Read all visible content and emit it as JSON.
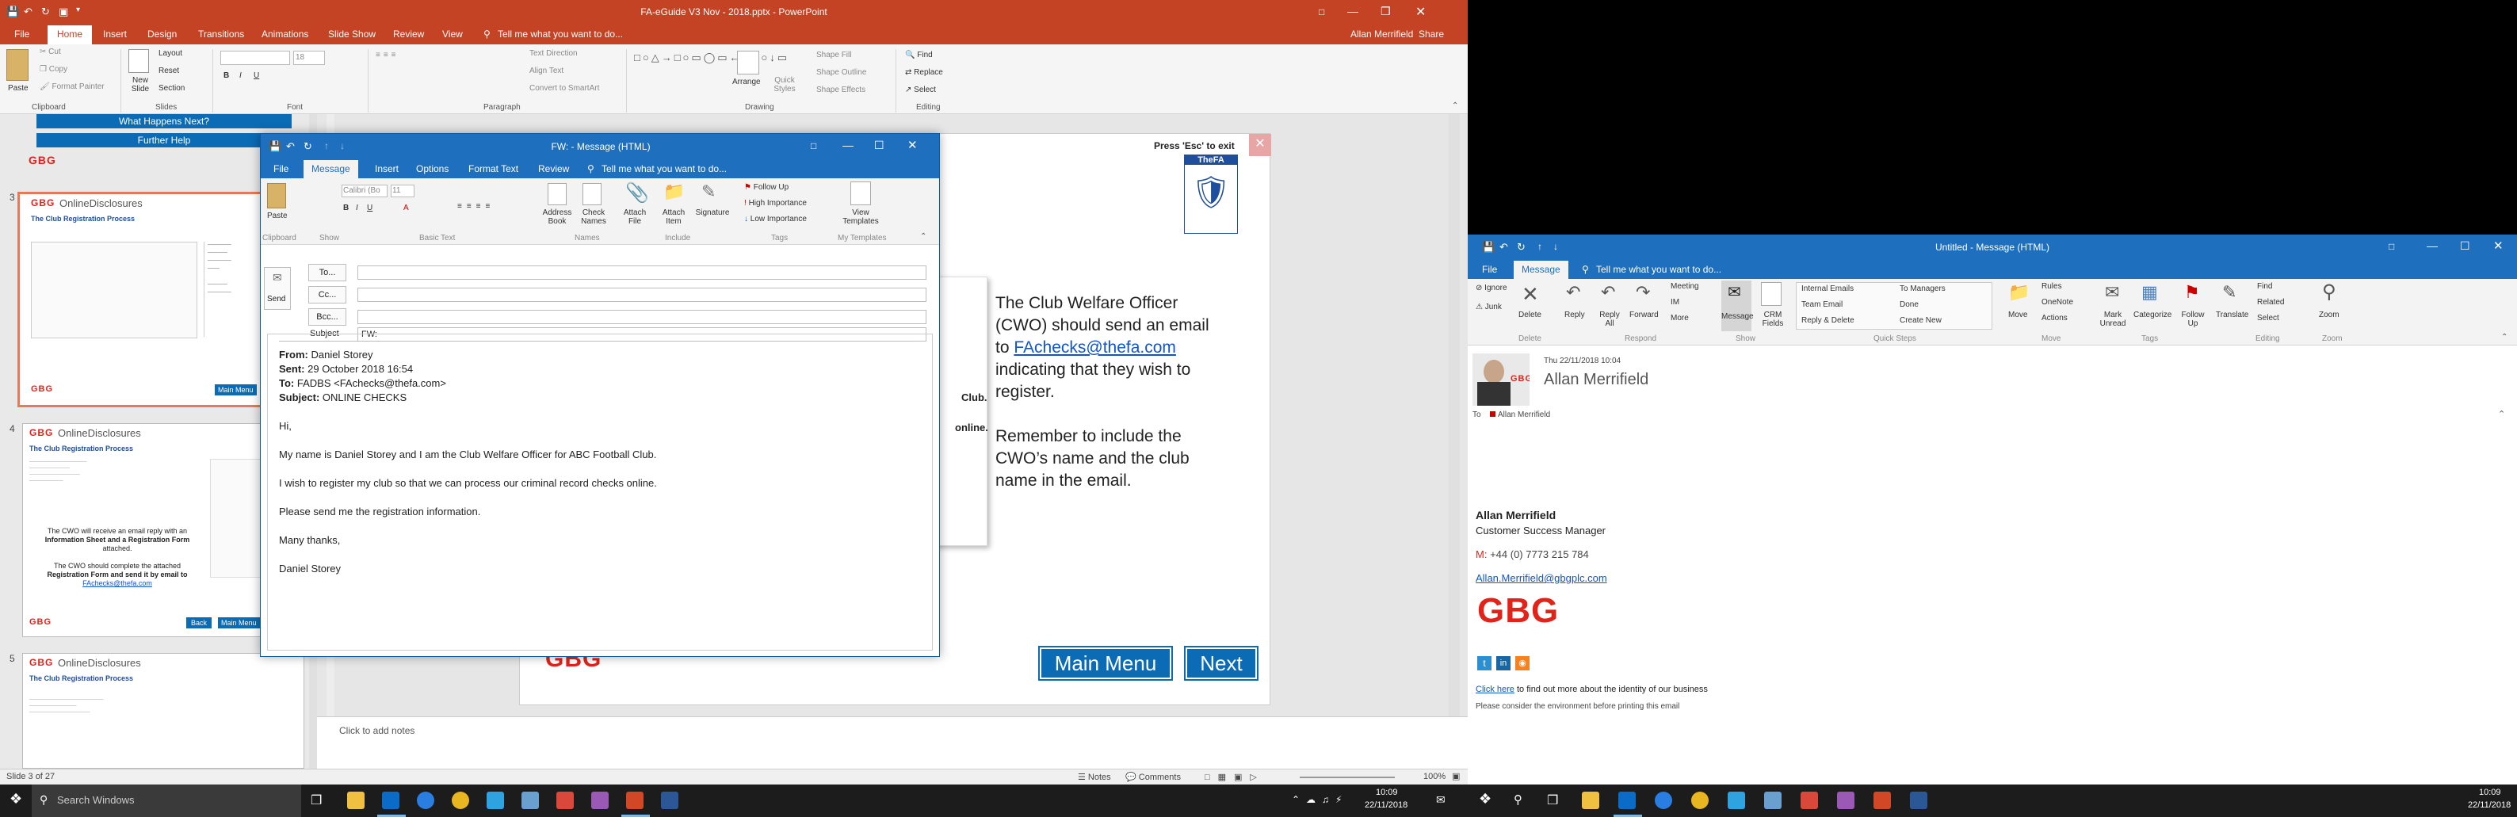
{
  "ppt": {
    "title": "FA-eGuide V3 Nov - 2018.pptx - PowerPoint",
    "user": "Allan Merrifield",
    "share": "Share",
    "tabs": [
      "File",
      "Home",
      "Insert",
      "Design",
      "Transitions",
      "Animations",
      "Slide Show",
      "Review",
      "View"
    ],
    "tell_me": "Tell me what you want to do...",
    "groups": {
      "clipboard": "Clipboard",
      "slides": "Slides",
      "font": "Font",
      "paragraph": "Paragraph",
      "drawing": "Drawing",
      "editing": "Editing"
    },
    "ribbon": {
      "paste": "Paste",
      "cut": "Cut",
      "copy": "Copy",
      "format_painter": "Format Painter",
      "new_slide": "New Slide",
      "layout": "Layout",
      "reset": "Reset",
      "section": "Section",
      "font_size": "18",
      "text_direction": "Text Direction",
      "align_text": "Align Text",
      "convert_smartart": "Convert to SmartArt",
      "arrange": "Arrange",
      "quick_styles": "Quick Styles",
      "shape_fill": "Shape Fill",
      "shape_outline": "Shape Outline",
      "shape_effects": "Shape Effects",
      "find": "Find",
      "replace": "Replace",
      "select": "Select"
    },
    "left_pane": {
      "banner1": "What Happens Next?",
      "banner2": "Further Help",
      "slides": [
        {
          "num": "3",
          "brand": "GBG",
          "title": "OnlineDisclosures",
          "subtitle": "The Club Registration Process",
          "button": "Main Menu"
        },
        {
          "num": "4",
          "brand": "GBG",
          "title": "OnlineDisclosures",
          "subtitle": "The Club Registration Process",
          "line1": "The CWO will receive an email reply with an",
          "line1b": "Information Sheet and a Registration Form",
          "line1c": "attached.",
          "line2": "The CWO should complete the attached",
          "line2b": "Registration Form and send it by email to",
          "line2c": "FAchecks@thefa.com",
          "back": "Back",
          "menu": "Main Menu"
        },
        {
          "num": "5",
          "brand": "GBG",
          "title": "OnlineDisclosures",
          "subtitle": "The Club Registration Process"
        }
      ]
    },
    "slide": {
      "press_esc": "Press 'Esc' to exit",
      "fa_label": "TheFA",
      "body1": "The Club Welfare Officer",
      "body2": "(CWO) should send an email",
      "body3_pre": "to ",
      "body3_link": "FAchecks@thefa.com",
      "body4": "indicating that they wish to",
      "body5": "register.",
      "body6": "Remember to include the",
      "body7": "CWO’s name and the club",
      "body8": "name in the email.",
      "peek1": "Club.",
      "peek2": "online.",
      "brand": "GBG",
      "main_menu": "Main Menu",
      "next": "Next"
    },
    "notes": "Click to add notes",
    "status": {
      "slide_of": "Slide 3 of 27",
      "notes": "Notes",
      "comments": "Comments",
      "zoom": "100%"
    }
  },
  "compose": {
    "title": "FW: - Message (HTML)",
    "tabs": [
      "File",
      "Message",
      "Insert",
      "Options",
      "Format Text",
      "Review"
    ],
    "tell_me": "Tell me what you want to do...",
    "ribbon": {
      "paste": "Paste",
      "font": "Calibri (Bo",
      "size": "11",
      "address_book": "Address Book",
      "check_names": "Check Names",
      "attach_file": "Attach File",
      "attach_item": "Attach Item",
      "signature": "Signature",
      "follow_up": "Follow Up",
      "high_importance": "High Importance",
      "low_importance": "Low Importance",
      "view_templates": "View Templates",
      "g_clipboard": "Clipboard",
      "g_show": "Show",
      "g_basic": "Basic Text",
      "g_names": "Names",
      "g_include": "Include",
      "g_tags": "Tags",
      "g_templates": "My Templates"
    },
    "send": "Send",
    "to": "To...",
    "cc": "Cc...",
    "bcc": "Bcc...",
    "subject_label": "Subject",
    "subject_value": "FW:",
    "from_label": "From:",
    "from_value": "Daniel Storey",
    "sent_label": "Sent:",
    "sent_value": "29 October 2018 16:54",
    "to_label": "To:",
    "to_value": "FADBS <FAchecks@thefa.com>",
    "subj_label": "Subject:",
    "subj_value": "ONLINE CHECKS",
    "body": [
      "Hi,",
      "My name is Daniel Storey and I am the Club Welfare Officer for ABC Football Club.",
      "I wish to register my club so that we can process our criminal record checks online.",
      "Please send me the registration information.",
      "Many thanks,",
      "Daniel Storey"
    ]
  },
  "taskbar1": {
    "search": "Search Windows",
    "time": "10:09",
    "date": "22/11/2018"
  },
  "reader": {
    "title": "Untitled - Message (HTML)",
    "tabs": [
      "File",
      "Message"
    ],
    "tell_me": "Tell me what you want to do...",
    "ribbon": {
      "ignore": "Ignore",
      "junk": "Junk",
      "delete": "Delete",
      "reply": "Reply",
      "reply_all": "Reply All",
      "forward": "Forward",
      "meeting": "Meeting",
      "im": "IM",
      "more": "More",
      "message": "Message",
      "crm": "CRM Fields",
      "internal_emails": "Internal Emails",
      "team_email": "Team Email",
      "reply_delete": "Reply & Delete",
      "to_managers": "To Managers",
      "done": "Done",
      "create_new": "Create New",
      "move": "Move",
      "rules": "Rules",
      "onenote": "OneNote",
      "actions": "Actions",
      "mark_unread": "Mark Unread",
      "categorize": "Categorize",
      "follow_up": "Follow Up",
      "translate": "Translate",
      "find": "Find",
      "related": "Related",
      "select": "Select",
      "zoom": "Zoom",
      "g_delete": "Delete",
      "g_respond": "Respond",
      "g_show": "Show",
      "g_quick": "Quick Steps",
      "g_move": "Move",
      "g_tags": "Tags",
      "g_editing": "Editing",
      "g_zoom": "Zoom"
    },
    "date": "Thu 22/11/2018 10:04",
    "sender": "Allan Merrifield",
    "to_label": "To",
    "to_value": "Allan Merrifield",
    "sig_name": "Allan Merrifield",
    "sig_role": "Customer Success Manager",
    "sig_m_label": "M:",
    "sig_phone": "+44 (0) 7773 215 784",
    "sig_email": "Allan.Merrifield@gbgplc.com",
    "sig_brand": "GBG",
    "click_here": "Click here",
    "click_rest": " to find out more about the identity of our business",
    "env": "Please consider the environment before printing this email"
  },
  "taskbar2": {
    "time": "10:09",
    "date": "22/11/2018"
  },
  "colors": {
    "ppt_accent": "#c44324",
    "outlook_accent": "#1f6fbf",
    "fa_blue": "#0b6bb5",
    "gbg_red": "#e2231a"
  }
}
